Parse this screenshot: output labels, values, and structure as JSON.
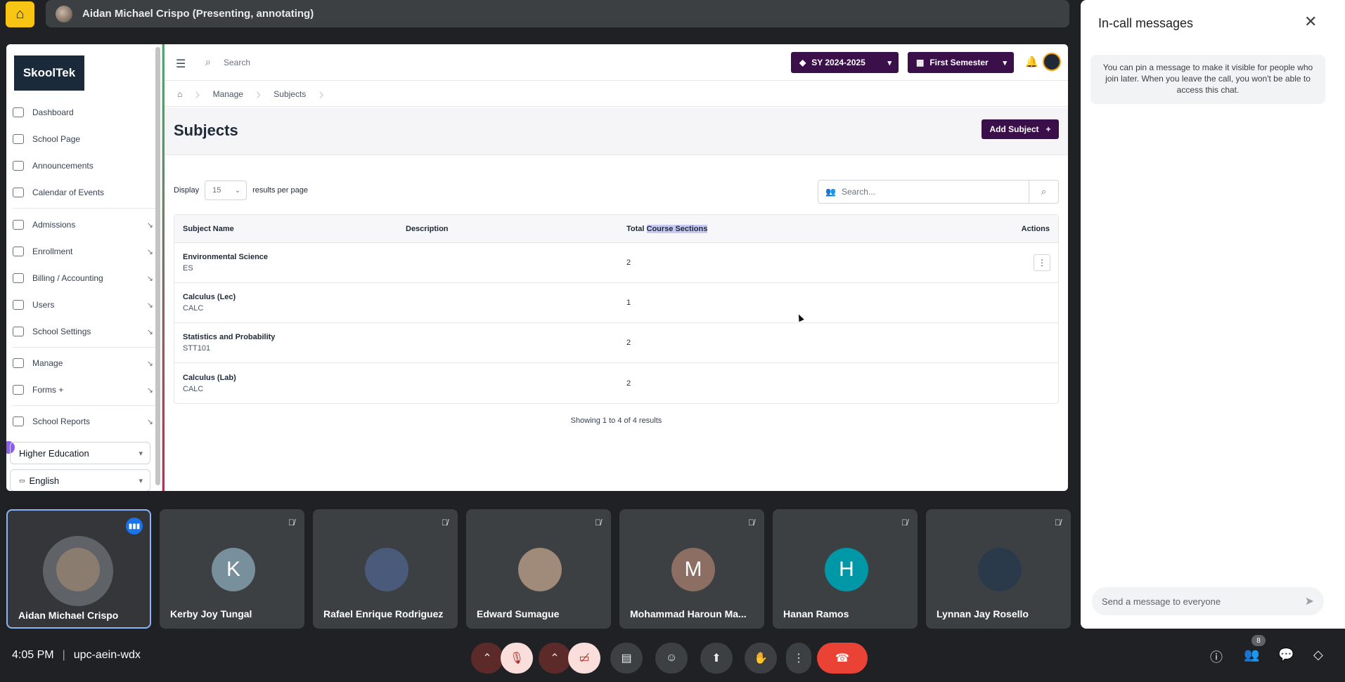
{
  "presenter": {
    "text": "Aidan Michael Crispo (Presenting, annotating)"
  },
  "app": {
    "brand": "SkoolTek",
    "search_placeholder": "Search",
    "school_year": "SY 2024-2025",
    "semester": "First Semester",
    "breadcrumbs": [
      "Manage",
      "Subjects"
    ],
    "page_title": "Subjects",
    "add_button": "Add Subject",
    "display_label": "Display",
    "per_page": "15",
    "per_page_label": "results per page",
    "table_search_placeholder": "Search...",
    "columns": [
      "Subject Name",
      "Description",
      "Total ",
      "Course Sections",
      "Actions"
    ],
    "rows": [
      {
        "name": "Environmental Science",
        "code": "ES",
        "description": "",
        "total": "2"
      },
      {
        "name": "Calculus (Lec)",
        "code": "CALC",
        "description": "",
        "total": "1"
      },
      {
        "name": "Statistics and Probability",
        "code": "STT101",
        "description": "",
        "total": "2"
      },
      {
        "name": "Calculus (Lab)",
        "code": "CALC",
        "description": "",
        "total": "2"
      }
    ],
    "showing": "Showing 1 to 4 of 4 results",
    "sidebar": [
      {
        "label": "Dashboard",
        "icon": "dashboard-icon"
      },
      {
        "label": "School Page",
        "icon": "globe-icon"
      },
      {
        "label": "Announcements",
        "icon": "megaphone-icon"
      },
      {
        "label": "Calendar of Events",
        "icon": "calendar-icon"
      },
      {
        "label": "Admissions",
        "icon": "users-icon"
      },
      {
        "label": "Enrollment",
        "icon": "book-icon"
      },
      {
        "label": "Billing / Accounting",
        "icon": "billing-icon"
      },
      {
        "label": "Users",
        "icon": "users-icon"
      },
      {
        "label": "School Settings",
        "icon": "gear-icon"
      },
      {
        "label": "Manage",
        "icon": "manage-icon"
      },
      {
        "label": "Forms +",
        "icon": "forms-icon"
      },
      {
        "label": "School Reports",
        "icon": "reports-icon"
      }
    ],
    "level": "Higher Education",
    "language": "English"
  },
  "chat": {
    "title": "In-call messages",
    "info": "You can pin a message to make it visible for people who join later. When you leave the call, you won't be able to access this chat.",
    "input_placeholder": "Send a message to everyone"
  },
  "participants": [
    {
      "name": "Aidan Michael Crispo",
      "initial": "",
      "color": "#8a7d70"
    },
    {
      "name": "Kerby Joy Tungal",
      "initial": "K",
      "color": "#78909c"
    },
    {
      "name": "Rafael Enrique Rodriguez",
      "initial": "",
      "color": "#4a5a7a"
    },
    {
      "name": "Edward Sumague",
      "initial": "",
      "color": "#a08a7a"
    },
    {
      "name": "Mohammad Haroun Ma...",
      "initial": "M",
      "color": "#8d6e63"
    },
    {
      "name": "Hanan Ramos",
      "initial": "H",
      "color": "#0097a7"
    },
    {
      "name": "Lynnan Jay Rosello",
      "initial": "",
      "color": "#2a3a4a"
    }
  ],
  "meeting": {
    "time": "4:05 PM",
    "code": "upc-aein-wdx",
    "people_count": "8"
  }
}
